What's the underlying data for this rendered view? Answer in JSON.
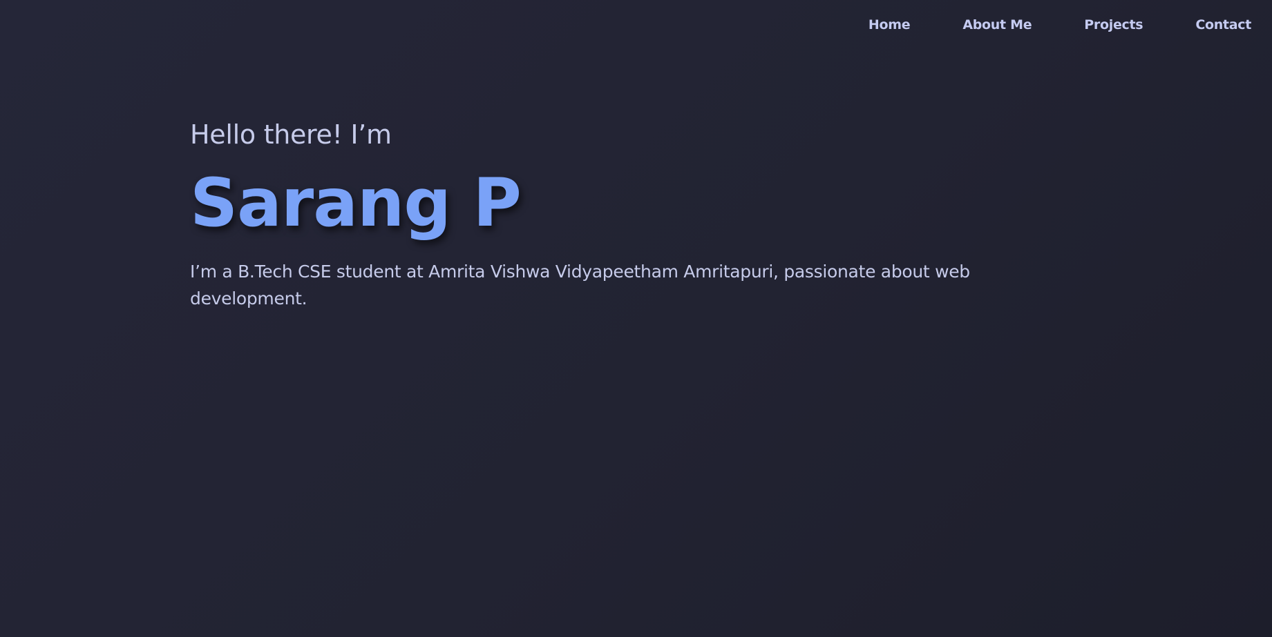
{
  "nav": {
    "items": [
      {
        "label": "Home"
      },
      {
        "label": "About Me"
      },
      {
        "label": "Projects"
      },
      {
        "label": "Contact"
      }
    ]
  },
  "hero": {
    "greeting": "Hello there! I’m",
    "name": "Sarang P",
    "bio": "I’m a B.Tech CSE student at Amrita Vishwa Vidyapeetham Amritapuri, passionate about web development."
  },
  "colors": {
    "background": "#232433",
    "accent": "#7aa2f7",
    "text": "#c6cbea"
  }
}
